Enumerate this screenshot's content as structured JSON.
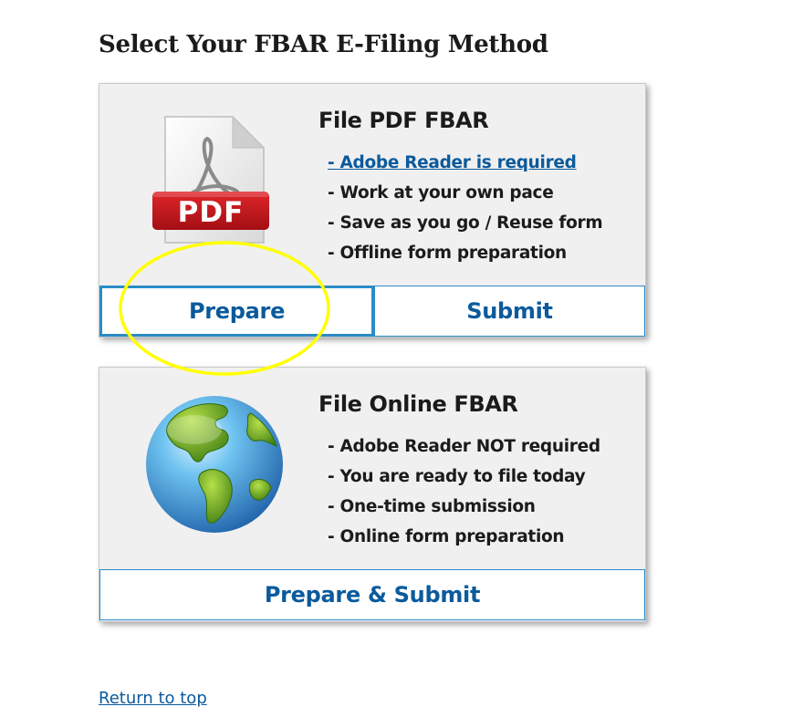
{
  "page": {
    "title": "Select Your FBAR E-Filing Method"
  },
  "pdf_option": {
    "title": "File PDF FBAR",
    "icon": "pdf-document-icon",
    "icon_label": "PDF",
    "features": {
      "link": "- Adobe Reader is required",
      "items": [
        "- Work at your own pace",
        "- Save as you go / Reuse form",
        "- Offline form preparation"
      ]
    },
    "buttons": {
      "prepare": "Prepare",
      "submit": "Submit"
    }
  },
  "online_option": {
    "title": "File Online FBAR",
    "icon": "globe-icon",
    "features": {
      "items": [
        "- Adobe Reader NOT required",
        "- You are ready to file today",
        "- One-time submission",
        "- Online form preparation"
      ]
    },
    "buttons": {
      "prepare_submit": "Prepare & Submit"
    }
  },
  "footer": {
    "return_link": "Return to top"
  },
  "annotation": {
    "highlight_color": "#ffff00",
    "target": "Prepare"
  },
  "colors": {
    "link": "#0b5a9c",
    "button_border": "#2a8cc6",
    "pdf_red": "#c6171b",
    "card_bg": "#f0f0f0"
  }
}
